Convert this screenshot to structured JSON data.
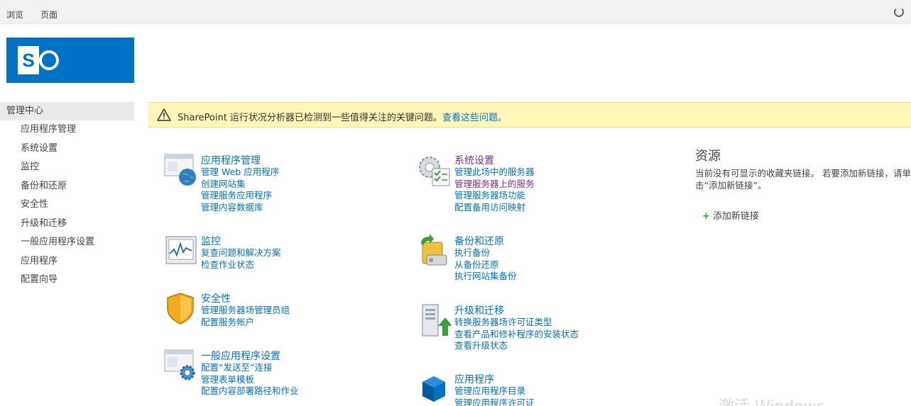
{
  "topbar": {
    "tabs": [
      "浏览",
      "页面"
    ],
    "sync_icon": "sync-icon"
  },
  "logo": {
    "letter": "S",
    "brand_color": "#0072c6"
  },
  "leftnav": {
    "heading": "管理中心",
    "items": [
      "应用程序管理",
      "系统设置",
      "监控",
      "备份和还原",
      "安全性",
      "升级和迁移",
      "一般应用程序设置",
      "应用程序",
      "配置向导"
    ]
  },
  "banner": {
    "message": "SharePoint 运行状况分析器已检测到一些值得关注的关键问题。",
    "link": "查看这些问题。",
    "background": "#fff6b8"
  },
  "categories": {
    "app_mgmt": {
      "title": "应用程序管理",
      "links": [
        "管理 Web 应用程序",
        "创建网站集",
        "管理服务应用程序",
        "管理内容数据库"
      ]
    },
    "system": {
      "title": "系统设置",
      "links": [
        "管理此场中的服务器",
        "管理服务器上的服务",
        "管理服务器场功能",
        "配置备用访问映射"
      ]
    },
    "monitor": {
      "title": "监控",
      "links": [
        "复查问题和解决方案",
        "检查作业状态"
      ]
    },
    "backup": {
      "title": "备份和还原",
      "links": [
        "执行备份",
        "从备份还原",
        "执行网站集备份"
      ]
    },
    "security": {
      "title": "安全性",
      "links": [
        "管理服务器场管理员组",
        "配置服务帐户"
      ]
    },
    "upgrade": {
      "title": "升级和迁移",
      "links": [
        "转换服务器场许可证类型",
        "查看产品和修补程序的安装状态",
        "查看升级状态"
      ]
    },
    "general": {
      "title": "一般应用程序设置",
      "links": [
        "配置“发送至”连接",
        "管理表单模板",
        "配置内容部署路径和作业"
      ]
    },
    "apps": {
      "title": "应用程序",
      "links": [
        "管理应用程序目录",
        "管理应用程序许可证"
      ]
    }
  },
  "resources": {
    "title": "资源",
    "text": "当前没有可显示的收藏夹链接。 若要添加新链接，请单击“添加新链接”。",
    "add_link": "添加新链接"
  },
  "watermark": "激活 Windows"
}
